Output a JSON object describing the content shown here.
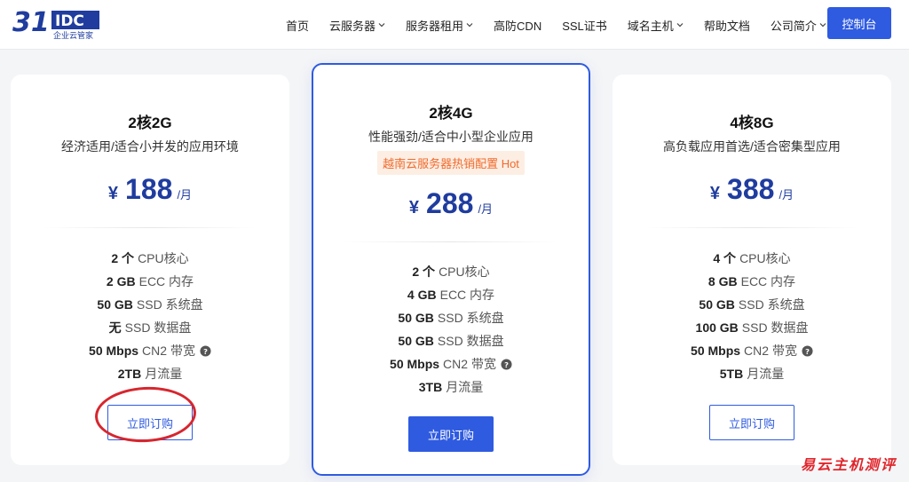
{
  "header": {
    "nav": [
      {
        "label": "首页",
        "dropdown": false
      },
      {
        "label": "云服务器",
        "dropdown": true
      },
      {
        "label": "服务器租用",
        "dropdown": true
      },
      {
        "label": "高防CDN",
        "dropdown": false
      },
      {
        "label": "SSL证书",
        "dropdown": false
      },
      {
        "label": "域名主机",
        "dropdown": true
      },
      {
        "label": "帮助文档",
        "dropdown": false
      },
      {
        "label": "公司简介",
        "dropdown": true
      }
    ],
    "console_label": "控制台"
  },
  "plans": [
    {
      "title": "2核2G",
      "subtitle": "经济适用/适合小并发的应用环境",
      "badge": "",
      "currency": "¥",
      "price": "188",
      "unit": "/月",
      "specs": [
        {
          "value": "2 个",
          "label": "CPU核心",
          "help": false
        },
        {
          "value": "2 GB",
          "label": "ECC 内存",
          "help": false
        },
        {
          "value": "50 GB",
          "label": "SSD 系统盘",
          "help": false
        },
        {
          "value": "无",
          "label": "SSD 数据盘",
          "help": false
        },
        {
          "value": "50 Mbps",
          "label": "CN2 带宽",
          "help": true
        },
        {
          "value": "2TB",
          "label": "月流量",
          "help": false
        }
      ],
      "order_label": "立即订购"
    },
    {
      "title": "2核4G",
      "subtitle": "性能强劲/适合中小型企业应用",
      "badge": "越南云服务器热销配置 Hot",
      "currency": "¥",
      "price": "288",
      "unit": "/月",
      "specs": [
        {
          "value": "2 个",
          "label": "CPU核心",
          "help": false
        },
        {
          "value": "4 GB",
          "label": "ECC 内存",
          "help": false
        },
        {
          "value": "50 GB",
          "label": "SSD 系统盘",
          "help": false
        },
        {
          "value": "50 GB",
          "label": "SSD 数据盘",
          "help": false
        },
        {
          "value": "50 Mbps",
          "label": "CN2 带宽",
          "help": true
        },
        {
          "value": "3TB",
          "label": "月流量",
          "help": false
        }
      ],
      "order_label": "立即订购"
    },
    {
      "title": "4核8G",
      "subtitle": "高负载应用首选/适合密集型应用",
      "badge": "",
      "currency": "¥",
      "price": "388",
      "unit": "/月",
      "specs": [
        {
          "value": "4 个",
          "label": "CPU核心",
          "help": false
        },
        {
          "value": "8 GB",
          "label": "ECC 内存",
          "help": false
        },
        {
          "value": "50 GB",
          "label": "SSD 系统盘",
          "help": false
        },
        {
          "value": "100 GB",
          "label": "SSD 数据盘",
          "help": false
        },
        {
          "value": "50 Mbps",
          "label": "CN2 带宽",
          "help": true
        },
        {
          "value": "5TB",
          "label": "月流量",
          "help": false
        }
      ],
      "order_label": "立即订购"
    }
  ],
  "watermark": "易云主机测评",
  "colors": {
    "accent": "#2f5be0",
    "price": "#1f3c9e",
    "hot": "#ef6b2c",
    "annotation": "#d7262e"
  }
}
